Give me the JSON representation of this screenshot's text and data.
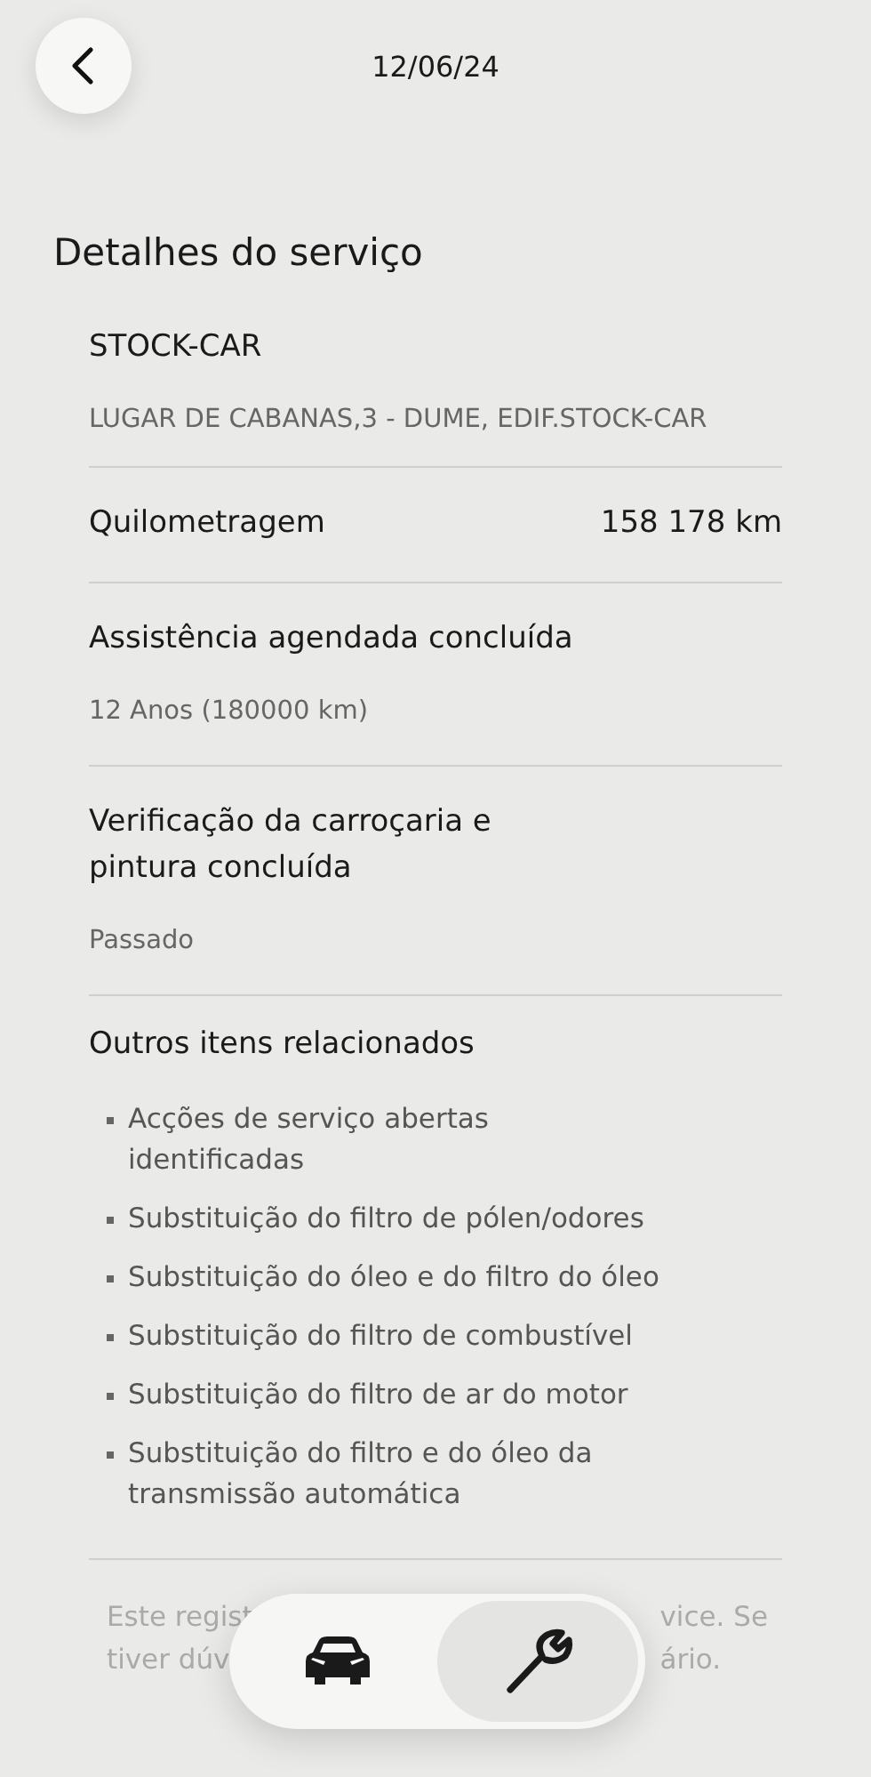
{
  "header": {
    "date": "12/06/24"
  },
  "title": "Detalhes do serviço",
  "sections": [
    {
      "kind": "dealer",
      "name": "STOCK-CAR",
      "detail": "LUGAR DE CABANAS,3 - DUME, EDIF.STOCK-CAR"
    },
    {
      "kind": "pair",
      "label": "Quilometragem",
      "value": "158 178 km"
    },
    {
      "kind": "status",
      "label": "Assistência agendada concluída",
      "detail": "12 Anos (180000 km)"
    },
    {
      "kind": "status",
      "label": "Verificação da carroçaria e pintura concluída",
      "detail": "Passado"
    },
    {
      "kind": "list",
      "label": "Outros itens relacionados",
      "items": [
        "Acções de serviço abertas identificadas",
        "Substituição do filtro de pólen/odores",
        "Substituição do óleo e do filtro do óleo",
        "Substituição do filtro de combustível",
        "Substituição do filtro de ar do motor",
        "Substituição do filtro e do óleo da transmissão automática"
      ]
    }
  ],
  "footer_note": {
    "left_lines": [
      "Este regist",
      "tiver dúv"
    ],
    "right_lines": [
      "vice. Se",
      "ário."
    ]
  },
  "nav_tabs": [
    {
      "kind": "car",
      "selected": false
    },
    {
      "kind": "wrench",
      "selected": true
    }
  ]
}
